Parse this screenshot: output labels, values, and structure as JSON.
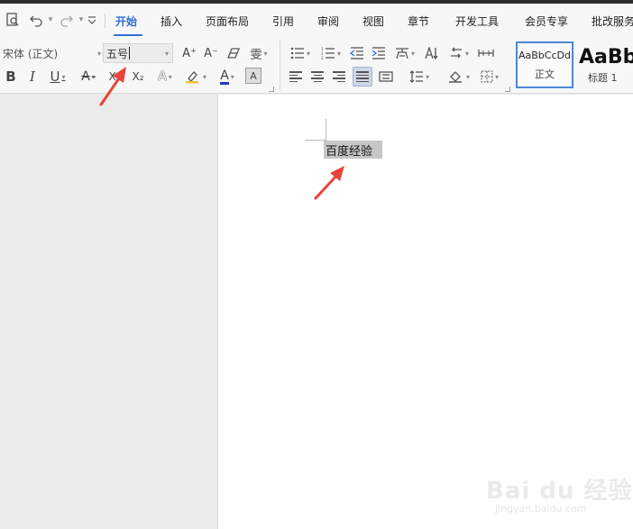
{
  "menu": {
    "tabs": [
      "开始",
      "插入",
      "页面布局",
      "引用",
      "审阅",
      "视图",
      "章节",
      "开发工具",
      "会员专享",
      "批改服务"
    ],
    "active_tab": "开始",
    "accent_color": "#2e6ed8"
  },
  "quick_access": {
    "icons": [
      "print-preview-icon",
      "undo-icon",
      "redo-icon",
      "customize-icon"
    ]
  },
  "ribbon": {
    "font_name": "宋体 (正文)",
    "font_size": "五号",
    "font_grow": "A⁺",
    "font_shrink": "A⁻",
    "pinyin_glyph": "雯",
    "bold": "B",
    "italic": "I",
    "underline": "U",
    "strike": "A",
    "superscript": "X²",
    "subscript": "X₂",
    "effects": "A",
    "font_color": "A",
    "char_shading": "A",
    "styles": [
      {
        "sample": "AaBbCcDd",
        "name": "正文"
      },
      {
        "sample": "AaBb",
        "name": "标题 1"
      }
    ]
  },
  "document": {
    "text": "百度经验",
    "selection_color": "#c6c6c6"
  },
  "annotations": {
    "arrow_color": "#e8433a"
  },
  "watermark": {
    "main": "Bai du 经验",
    "sub": "jingyan.baidu.com"
  }
}
